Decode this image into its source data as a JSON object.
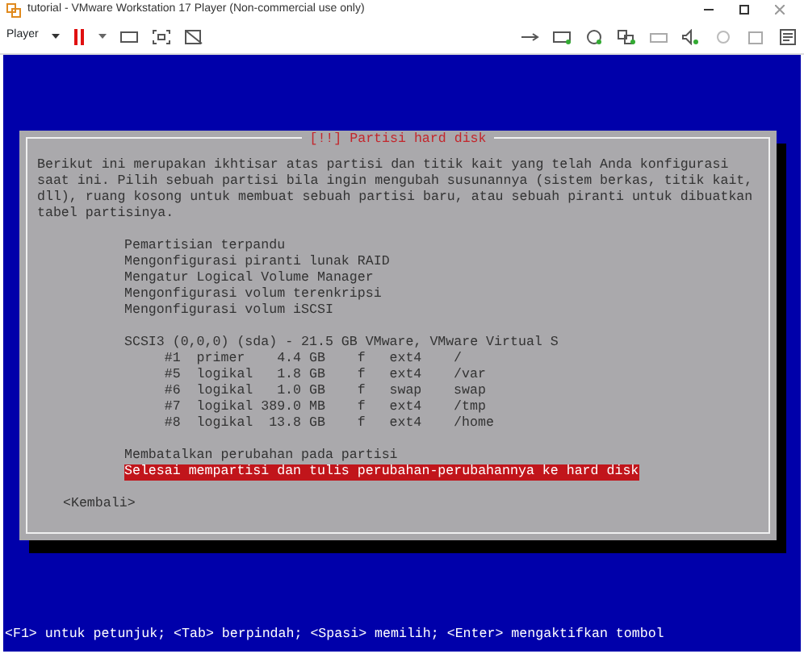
{
  "window": {
    "title": "tutorial - VMware Workstation 17 Player (Non-commercial use only)"
  },
  "toolbar": {
    "player_menu": "Player"
  },
  "dialog": {
    "title": "[!!] Partisi hard disk",
    "description": "Berikut ini merupakan ikhtisar atas partisi dan titik kait yang telah Anda konfigurasi saat ini. Pilih sebuah partisi bila ingin mengubah susunannya (sistem berkas, titik kait, dll), ruang kosong untuk membuat sebuah partisi baru, atau sebuah piranti untuk dibuatkan tabel partisinya.",
    "menu_items": [
      {
        "label": "Pemartisian terpandu",
        "selected": false
      },
      {
        "label": "Mengonfigurasi piranti lunak RAID",
        "selected": false
      },
      {
        "label": "Mengatur Logical Volume Manager",
        "selected": false
      },
      {
        "label": "Mengonfigurasi volum terenkripsi",
        "selected": false
      },
      {
        "label": "Mengonfigurasi volum iSCSI",
        "selected": false
      }
    ],
    "disk": {
      "label": "SCSI3 (0,0,0) (sda) - 21.5 GB VMware, VMware Virtual S",
      "selected": false
    },
    "partitions": [
      {
        "number": "#1",
        "type": "primer",
        "size": "4.4 GB",
        "flag": "f",
        "fs": "ext4",
        "mount": "/",
        "selected": false
      },
      {
        "number": "#5",
        "type": "logikal",
        "size": "1.8 GB",
        "flag": "f",
        "fs": "ext4",
        "mount": "/var",
        "selected": false
      },
      {
        "number": "#6",
        "type": "logikal",
        "size": "1.0 GB",
        "flag": "f",
        "fs": "swap",
        "mount": "swap",
        "selected": false
      },
      {
        "number": "#7",
        "type": "logikal",
        "size": "389.0 MB",
        "flag": "f",
        "fs": "ext4",
        "mount": "/tmp",
        "selected": false
      },
      {
        "number": "#8",
        "type": "logikal",
        "size": "13.8 GB",
        "flag": "f",
        "fs": "ext4",
        "mount": "/home",
        "selected": false
      }
    ],
    "actions": [
      {
        "label": "Membatalkan perubahan pada partisi",
        "selected": false
      },
      {
        "label": "Selesai mempartisi dan tulis perubahan-perubahannya ke hard disk",
        "selected": true
      }
    ],
    "back_button": "<Kembali>"
  },
  "status_bar": "<F1> untuk petunjuk; <Tab> berpindah; <Spasi> memilih; <Enter> mengaktifkan tombol"
}
